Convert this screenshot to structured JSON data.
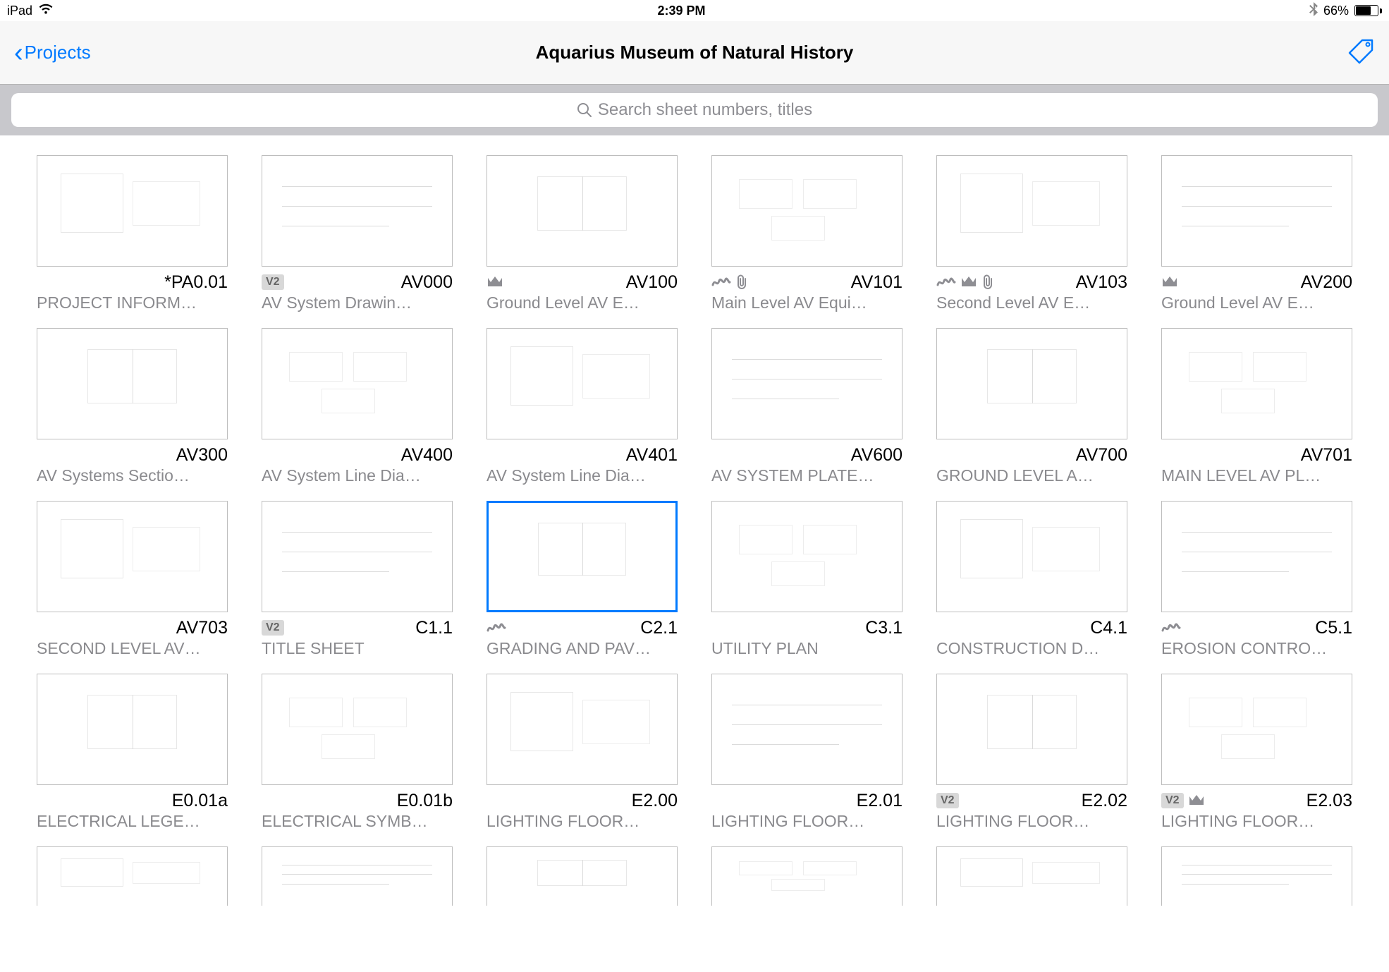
{
  "status": {
    "device": "iPad",
    "time": "2:39 PM",
    "battery_pct": "66%"
  },
  "nav": {
    "back_label": "Projects",
    "title": "Aquarius Museum of Natural History"
  },
  "search": {
    "placeholder": "Search sheet numbers, titles"
  },
  "badges": {
    "v2": "V2"
  },
  "sheets": [
    {
      "number": "*PA0.01",
      "title": "PROJECT INFORM…",
      "badges": [],
      "selected": false
    },
    {
      "number": "AV000",
      "title": "AV System Drawin…",
      "badges": [
        "v2"
      ],
      "selected": false
    },
    {
      "number": "AV100",
      "title": "Ground Level AV E…",
      "badges": [
        "crown"
      ],
      "selected": false
    },
    {
      "number": "AV101",
      "title": "Main Level AV Equi…",
      "badges": [
        "squiggle",
        "clip"
      ],
      "selected": false
    },
    {
      "number": "AV103",
      "title": "Second Level AV E…",
      "badges": [
        "squiggle",
        "crown",
        "clip"
      ],
      "selected": false
    },
    {
      "number": "AV200",
      "title": "Ground Level AV E…",
      "badges": [
        "crown"
      ],
      "selected": false
    },
    {
      "number": "AV300",
      "title": "AV Systems Sectio…",
      "badges": [],
      "selected": false
    },
    {
      "number": "AV400",
      "title": "AV System Line Dia…",
      "badges": [],
      "selected": false
    },
    {
      "number": "AV401",
      "title": "AV System Line Dia…",
      "badges": [],
      "selected": false
    },
    {
      "number": "AV600",
      "title": "AV SYSTEM PLATE…",
      "badges": [],
      "selected": false
    },
    {
      "number": "AV700",
      "title": "GROUND LEVEL A…",
      "badges": [],
      "selected": false
    },
    {
      "number": "AV701",
      "title": "MAIN LEVEL AV PL…",
      "badges": [],
      "selected": false
    },
    {
      "number": "AV703",
      "title": "SECOND LEVEL AV…",
      "badges": [],
      "selected": false
    },
    {
      "number": "C1.1",
      "title": "TITLE SHEET",
      "badges": [
        "v2"
      ],
      "selected": false
    },
    {
      "number": "C2.1",
      "title": "GRADING AND PAV…",
      "badges": [
        "squiggle"
      ],
      "selected": true
    },
    {
      "number": "C3.1",
      "title": "UTILITY PLAN",
      "badges": [],
      "selected": false
    },
    {
      "number": "C4.1",
      "title": "CONSTRUCTION D…",
      "badges": [],
      "selected": false
    },
    {
      "number": "C5.1",
      "title": "EROSION CONTRO…",
      "badges": [
        "squiggle"
      ],
      "selected": false
    },
    {
      "number": "E0.01a",
      "title": "ELECTRICAL LEGE…",
      "badges": [],
      "selected": false
    },
    {
      "number": "E0.01b",
      "title": "ELECTRICAL SYMB…",
      "badges": [],
      "selected": false
    },
    {
      "number": "E2.00",
      "title": "LIGHTING FLOOR…",
      "badges": [],
      "selected": false
    },
    {
      "number": "E2.01",
      "title": "LIGHTING FLOOR…",
      "badges": [],
      "selected": false
    },
    {
      "number": "E2.02",
      "title": "LIGHTING FLOOR…",
      "badges": [
        "v2"
      ],
      "selected": false
    },
    {
      "number": "E2.03",
      "title": "LIGHTING FLOOR…",
      "badges": [
        "v2",
        "crown"
      ],
      "selected": false
    },
    {
      "number": "",
      "title": "",
      "badges": [],
      "selected": false,
      "partial": true
    },
    {
      "number": "",
      "title": "",
      "badges": [],
      "selected": false,
      "partial": true
    },
    {
      "number": "",
      "title": "",
      "badges": [],
      "selected": false,
      "partial": true
    },
    {
      "number": "",
      "title": "",
      "badges": [],
      "selected": false,
      "partial": true
    },
    {
      "number": "",
      "title": "",
      "badges": [],
      "selected": false,
      "partial": true
    },
    {
      "number": "",
      "title": "",
      "badges": [],
      "selected": false,
      "partial": true
    }
  ]
}
